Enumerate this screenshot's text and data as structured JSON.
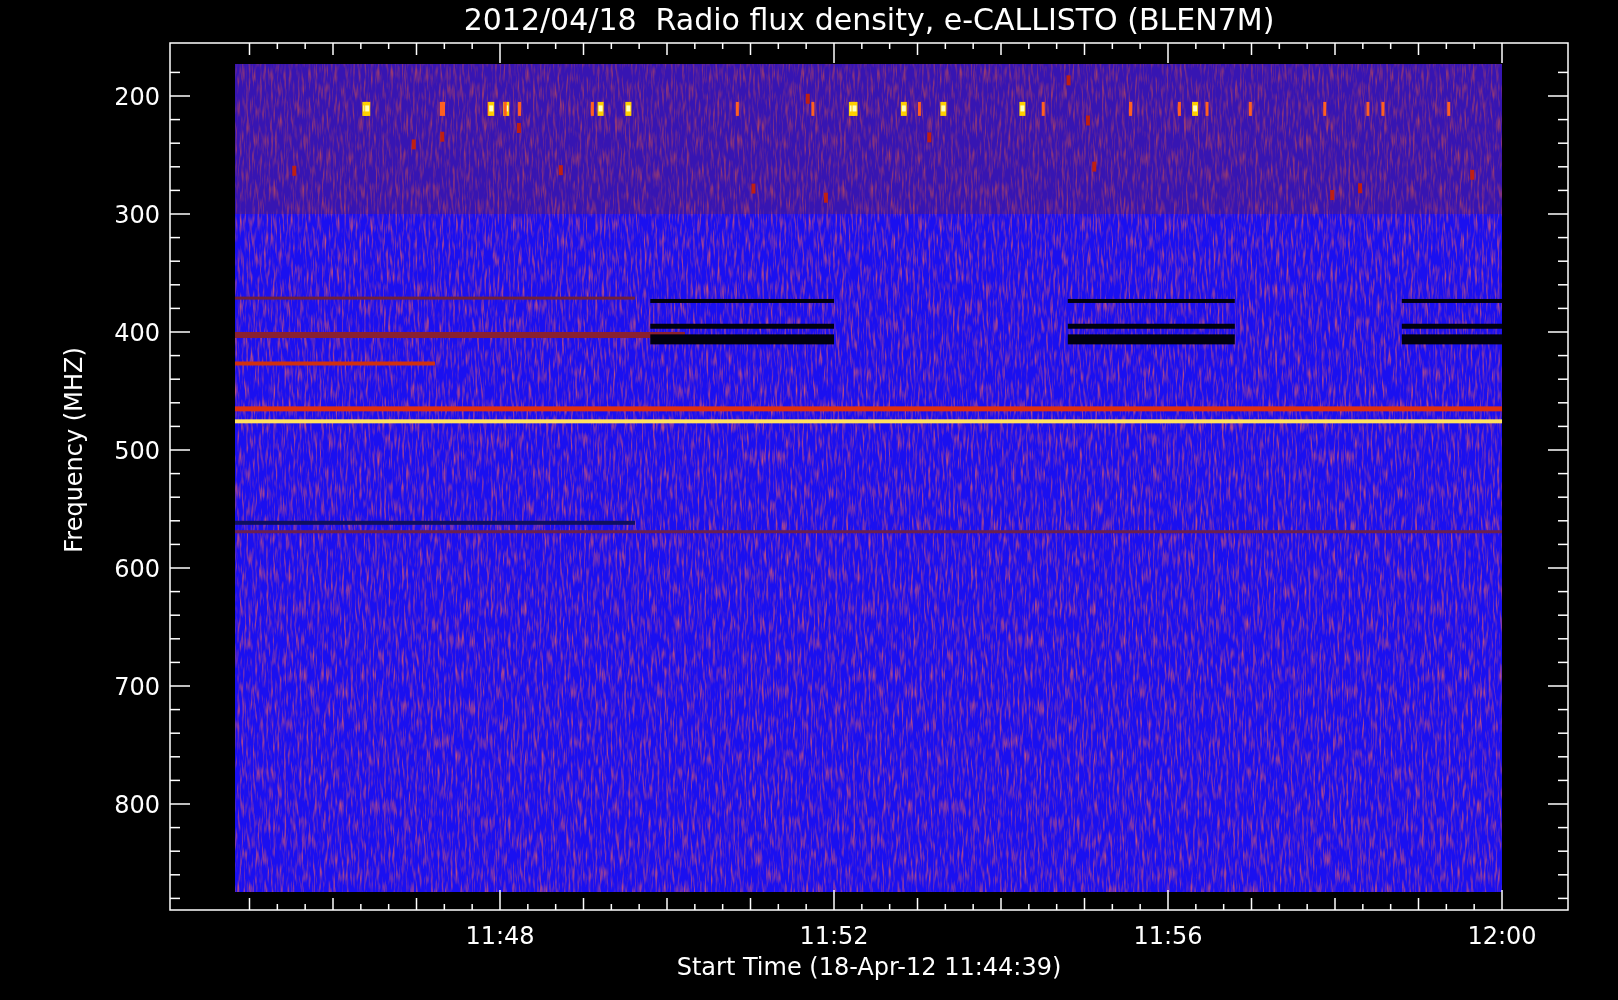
{
  "title": "2012/04/18  Radio flux density, e-CALLISTO (BLEN7M)",
  "y_axis": {
    "label": "Frequency (MHZ)",
    "ticks": [
      "200",
      "300",
      "400",
      "500",
      "600",
      "700",
      "800"
    ]
  },
  "x_axis": {
    "label": "Start Time (18-Apr-12 11:44:39)",
    "ticks": [
      "11:48",
      "11:52",
      "11:56",
      "12:00"
    ]
  }
}
